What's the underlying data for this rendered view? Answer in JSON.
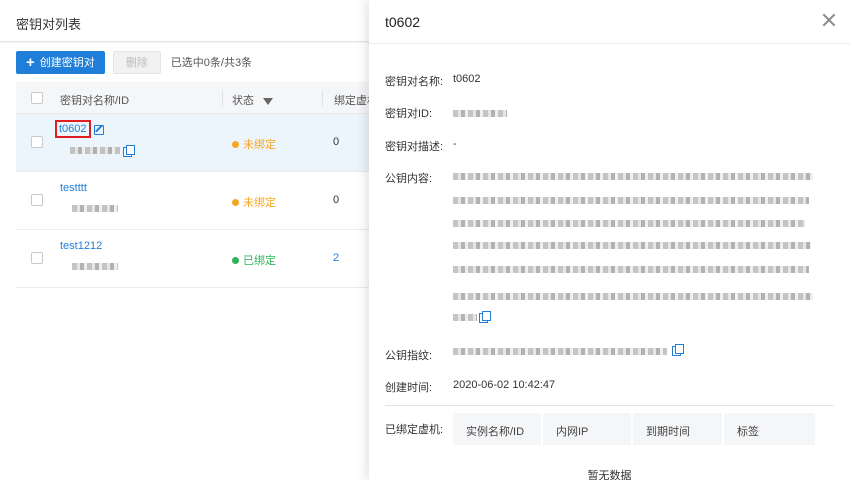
{
  "list_page": {
    "title": "密钥对列表",
    "create_button": "创建密钥对",
    "delete_button": "删除",
    "selection_info": "已选中0条/共3条",
    "columns": {
      "name_id": "密钥对名称/ID",
      "status": "状态",
      "bound_vms": "绑定虚机"
    },
    "rows": [
      {
        "name": "t0602",
        "status": "未绑定",
        "status_color": "#f5a623",
        "count": "0"
      },
      {
        "name": "testttt",
        "status": "未绑定",
        "status_color": "#f5a623",
        "count": "0"
      },
      {
        "name": "test1212",
        "status": "已绑定",
        "status_color": "#2fb35a",
        "count": "2"
      }
    ]
  },
  "drawer": {
    "title": "t0602",
    "fields": {
      "name_label": "密钥对名称:",
      "name_value": "t0602",
      "id_label": "密钥对ID:",
      "desc_label": "密钥对描述:",
      "desc_value": "-",
      "pubkey_label": "公钥内容:",
      "fingerprint_label": "公钥指纹:",
      "created_label": "创建时间:",
      "created_value": "2020-06-02 10:42:47",
      "bound_label": "已绑定虚机:"
    },
    "vm_columns": [
      "实例名称/ID",
      "内网IP",
      "到期时间",
      "标签"
    ],
    "empty_text": "暂无数据"
  },
  "colors": {
    "primary": "#1f7ed8",
    "unbound": "#f5a623",
    "bound": "#2fb35a",
    "highlight_box": "#e02020"
  }
}
